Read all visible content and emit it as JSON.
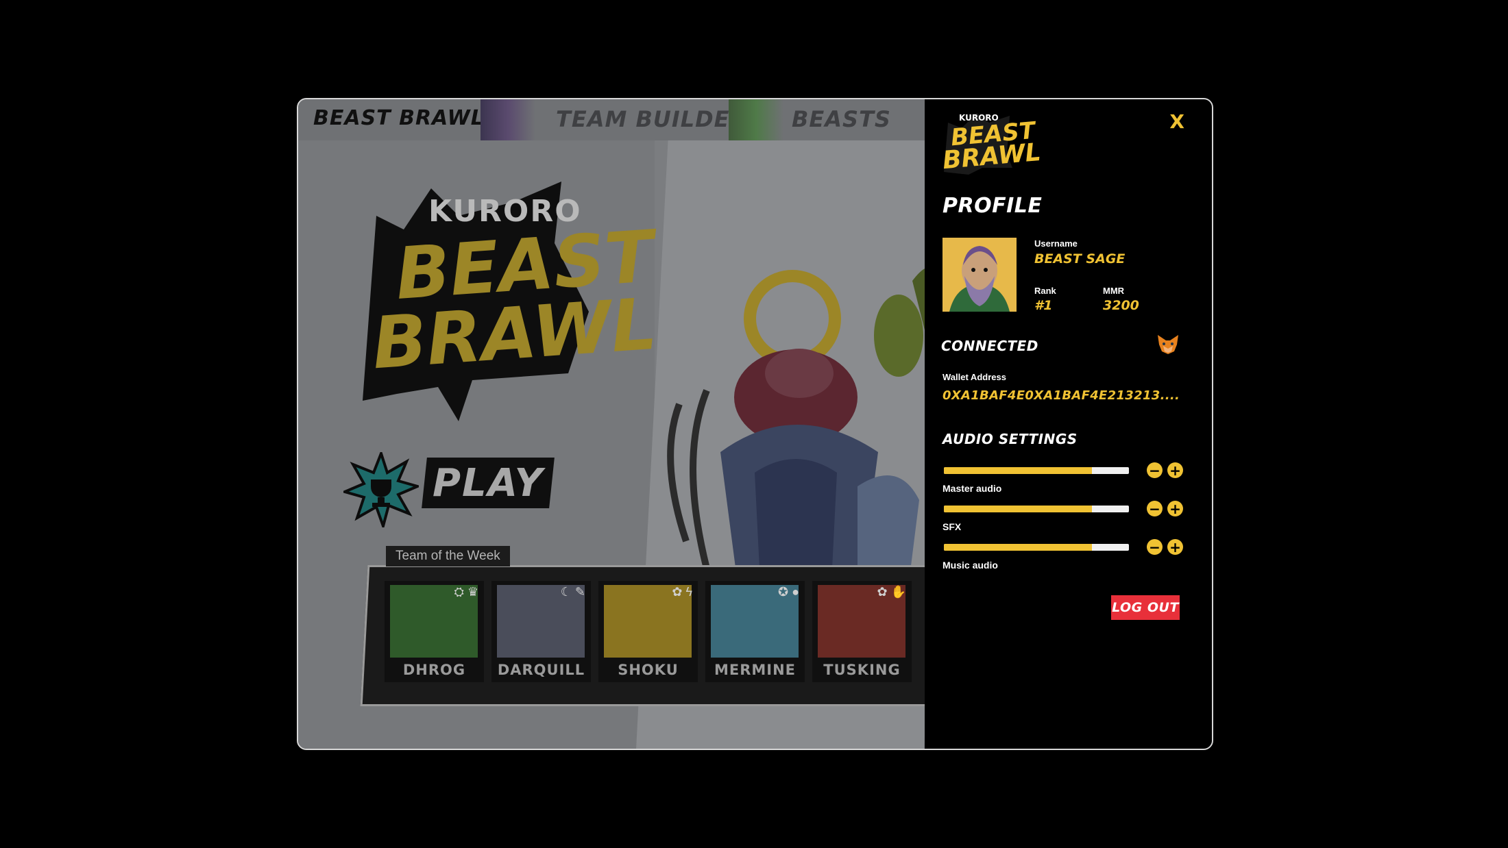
{
  "nav": {
    "home": "BEAST BRAWL",
    "team_builder": "TEAM BUILDER",
    "beasts": "BEASTS"
  },
  "hero_logo": {
    "kuroro": "KURORO",
    "beast": "BEAST",
    "brawl": "BRAWL"
  },
  "play_label": "PLAY",
  "team_of_week": {
    "label": "Team of the Week",
    "beasts": [
      {
        "name": "DHROG",
        "color": "#2f5a2a"
      },
      {
        "name": "DARQUILL",
        "color": "#4a4d5a"
      },
      {
        "name": "SHOKU",
        "color": "#8a7420"
      },
      {
        "name": "MERMINE",
        "color": "#3a6a7a"
      },
      {
        "name": "TUSKING",
        "color": "#6a2a24"
      }
    ]
  },
  "profile_panel": {
    "close_label": "X",
    "mini_logo": {
      "kuroro": "KURORO",
      "beast": "BEAST",
      "brawl": "BRAWL"
    },
    "title": "PROFILE",
    "username_label": "Username",
    "username": "BEAST SAGE",
    "rank_label": "Rank",
    "rank": "#1",
    "mmr_label": "MMR",
    "mmr": "3200",
    "connected_title": "CONNECTED",
    "wallet_icon": "metamask-fox-icon",
    "wallet_label": "Wallet Address",
    "wallet_address": "0XA1BAF4E0XA1BAF4E213213....",
    "audio_title": "AUDIO SETTINGS",
    "audio": [
      {
        "label": "Master audio",
        "level": 0.8
      },
      {
        "label": "SFX",
        "level": 0.8
      },
      {
        "label": "Music audio",
        "level": 0.8
      }
    ],
    "logout_label": "LOG OUT"
  },
  "colors": {
    "accent": "#f0c233",
    "danger": "#e8303a",
    "panel_bg": "#000000"
  }
}
